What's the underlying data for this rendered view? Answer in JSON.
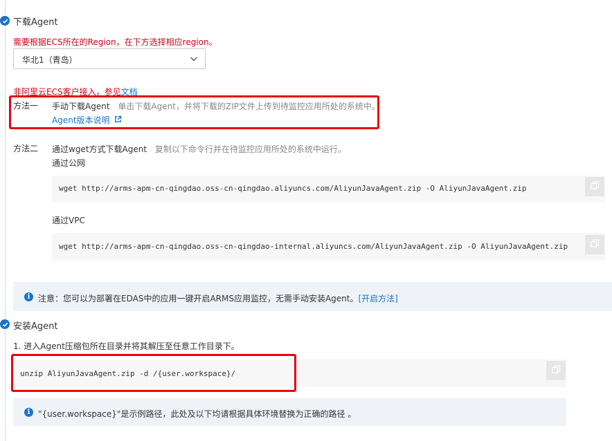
{
  "step1": {
    "title": "下载Agent",
    "region_hint": "需要根据ECS所在的Region，在下方选择相应region。",
    "region_select": {
      "value": "华北1（青岛）"
    },
    "non_ecs_prefix": "非阿里云ECS客户接入，参见",
    "non_ecs_link": "文档",
    "method1": {
      "label": "方法一",
      "title": "手动下载Agent",
      "desc": "单击下载Agent，并将下载的ZIP文件上传到待监控应用所处的系统中。",
      "link": "Agent版本说明"
    },
    "method2": {
      "label": "方法二",
      "title": "通过wget方式下载Agent",
      "desc": "复制以下命令行并在待监控应用所处的系统中运行。",
      "public_label": "通过公网",
      "public_cmd": "wget http://arms-apm-cn-qingdao.oss-cn-qingdao.aliyuncs.com/AliyunJavaAgent.zip -O AliyunJavaAgent.zip",
      "vpc_label": "通过VPC",
      "vpc_cmd": "wget http://arms-apm-cn-qingdao.oss-cn-qingdao-internal.aliyuncs.com/AliyunJavaAgent.zip -O AliyunJavaAgent.zip"
    },
    "notice": {
      "text": "注意：您可以为部署在EDAS中的应用一键开启ARMS应用监控，无需手动安装Agent。",
      "link": "[开启方法]"
    }
  },
  "step2": {
    "title": "安装Agent",
    "instruction": "1. 进入Agent压缩包所在目录并将其解压至任意工作目录下。",
    "cmd": "unzip AliyunJavaAgent.zip -d /{user.workspace}/",
    "notice": "\"{user.workspace}\"是示例路径，此处及以下均请根据具体环境替换为正确的路径 。"
  },
  "colors": {
    "accent": "#1a73c9",
    "highlight": "#e60012",
    "warning_text": "#d0021b"
  },
  "icons": [
    "check-circle-icon",
    "chevron-down-icon",
    "external-link-icon",
    "copy-icon",
    "info-icon"
  ]
}
